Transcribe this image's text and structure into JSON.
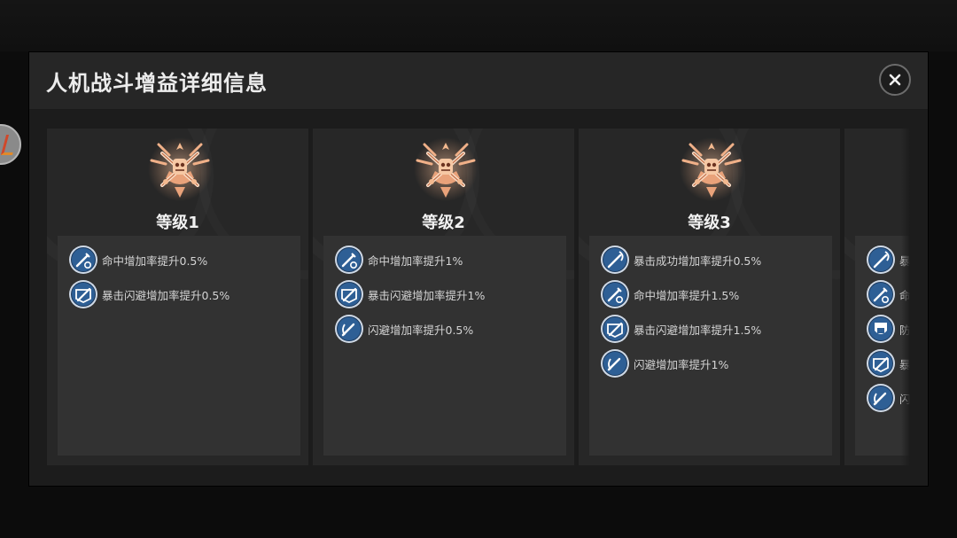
{
  "dialog": {
    "title": "人机战斗增益详细信息",
    "close_icon": "close-icon"
  },
  "colors": {
    "emblem": "#e8a47a",
    "icon_blue": "#2e5f95",
    "icon_ring": "#cfd9e6"
  },
  "cards": [
    {
      "level": "等级1",
      "buffs": [
        {
          "icon": "sword-icon",
          "text": "命中增加率提升0.5%"
        },
        {
          "icon": "evade-icon",
          "text": "暴击闪避增加率提升0.5%"
        }
      ]
    },
    {
      "level": "等级2",
      "buffs": [
        {
          "icon": "sword-icon",
          "text": "命中增加率提升1%"
        },
        {
          "icon": "evade-icon",
          "text": "暴击闪避增加率提升1%"
        },
        {
          "icon": "dodge-icon",
          "text": "闪避增加率提升0.5%"
        }
      ]
    },
    {
      "level": "等级3",
      "buffs": [
        {
          "icon": "critical-icon",
          "text": "暴击成功增加率提升0.5%"
        },
        {
          "icon": "sword-icon",
          "text": "命中增加率提升1.5%"
        },
        {
          "icon": "evade-icon",
          "text": "暴击闪避增加率提升1.5%"
        },
        {
          "icon": "dodge-icon",
          "text": "闪避增加率提升1%"
        }
      ]
    },
    {
      "level": "",
      "buffs": [
        {
          "icon": "critical-icon",
          "text": "暴"
        },
        {
          "icon": "sword-icon",
          "text": "命"
        },
        {
          "icon": "shield-icon",
          "text": "防"
        },
        {
          "icon": "evade-icon",
          "text": "暴"
        },
        {
          "icon": "dodge-icon",
          "text": "闪"
        }
      ]
    }
  ]
}
